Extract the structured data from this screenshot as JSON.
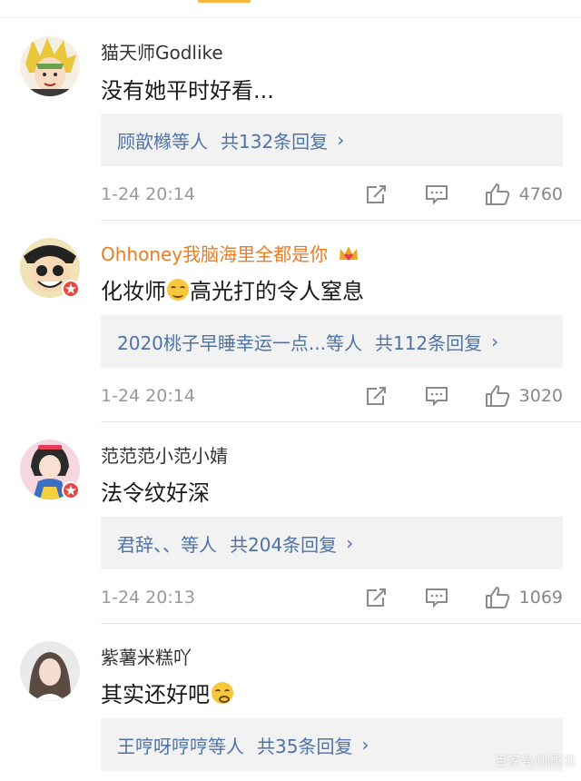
{
  "comments": [
    {
      "username": "猫天师Godlike",
      "text": "没有她平时好看...",
      "reply_who": "顾歆橼",
      "reply_etc": "等人",
      "reply_total": "共132条回复",
      "time": "1-24 20:14",
      "likes": "4760"
    },
    {
      "username": "Ohhoney我脑海里全都是你",
      "text_before": "化妆师",
      "text_after": "高光打的令人窒息",
      "reply_who": "2020桃子早睡幸运一点...",
      "reply_etc": "等人",
      "reply_total": "共112条回复",
      "time": "1-24 20:14",
      "likes": "3020"
    },
    {
      "username": "范范范小范小婧",
      "text": "法令纹好深",
      "reply_who": "君辞、、",
      "reply_etc": "等人",
      "reply_total": "共204条回复",
      "time": "1-24 20:13",
      "likes": "1069"
    },
    {
      "username": "紫薯米糕吖",
      "text": "其实还好吧",
      "reply_who": "王哼呀哼哼",
      "reply_etc": "等人",
      "reply_total": "共35条回复"
    }
  ],
  "icons": {
    "repost": "repost-icon",
    "comment": "comment-icon",
    "like": "thumbs-up-icon",
    "chevron": "chevron-right-icon",
    "verified": "verified-badge-icon"
  },
  "colors": {
    "link": "#4f73a6",
    "highlight_username": "#ee7b1e",
    "reply_bg": "#f2f2f2",
    "meta": "#999999",
    "verified_badge": "#e8483f",
    "tab_accent": "#f5b73b"
  },
  "watermark": "百家号/帅影视"
}
